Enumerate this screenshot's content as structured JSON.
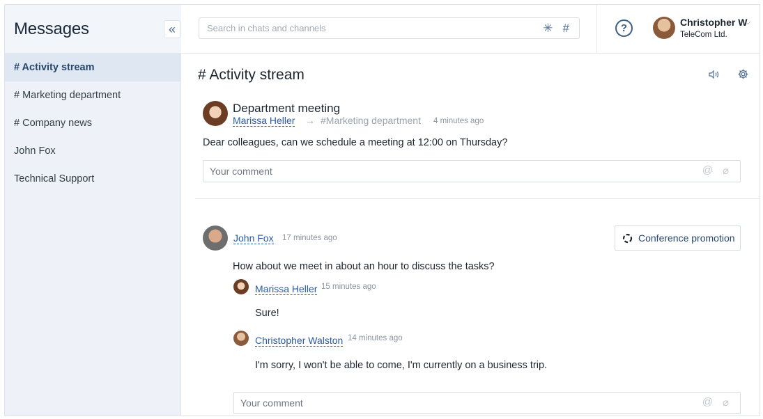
{
  "sidebar": {
    "title": "Messages",
    "collapse_icon": "«",
    "items": [
      {
        "label": "# Activity stream",
        "active": true
      },
      {
        "label": "# Marketing department"
      },
      {
        "label": "# Company news"
      },
      {
        "label": "John Fox"
      },
      {
        "label": "Technical Support"
      }
    ]
  },
  "header": {
    "search_placeholder": "Search in chats and channels",
    "search_icons": [
      "asterisk-icon",
      "hash-icon"
    ],
    "help_label": "?",
    "user": {
      "name": "Christopher W",
      "company": "TeleCom Ltd."
    }
  },
  "main": {
    "title": "# Activity stream",
    "post1": {
      "title": "Department meeting",
      "author": "Marissa Heller",
      "arrow": "→",
      "channel": "#Marketing department",
      "time": "4 minutes ago",
      "body": "Dear colleagues, can we schedule a meeting at 12:00 on Thursday?",
      "comment_placeholder": "Your comment"
    },
    "post2": {
      "author": "John Fox",
      "time": "17 minutes ago",
      "button": "Conference promotion",
      "body": "How about we meet in about an hour to discuss the tasks?",
      "replies": [
        {
          "author": "Marissa Heller",
          "time": "15 minutes ago",
          "body": "Sure!"
        },
        {
          "author": "Christopher Walston",
          "time": "14 minutes ago",
          "body": "I'm sorry, I won't be able to come, I'm currently on a business trip."
        }
      ],
      "comment_placeholder": "Your comment"
    }
  },
  "colors": {
    "accent": "#2a5aa0",
    "sidebar_bg": "#eef2f8",
    "active_item_bg": "#dfe8f2"
  }
}
